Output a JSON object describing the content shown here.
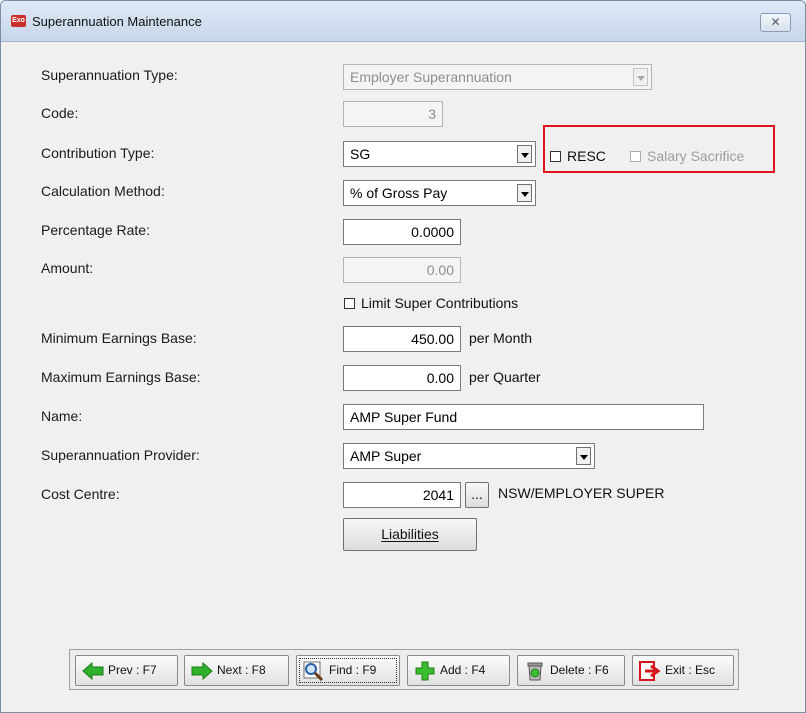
{
  "window": {
    "title": "Superannuation Maintenance",
    "app_icon_text": "Exo",
    "close_symbol": "✕"
  },
  "form": {
    "super_type": {
      "label": "Superannuation Type:",
      "value": "Employer Superannuation"
    },
    "code": {
      "label": "Code:",
      "value": "3"
    },
    "contribution_type": {
      "label": "Contribution Type:",
      "value": "SG"
    },
    "resc": {
      "label": "RESC",
      "checked": false
    },
    "salary_sacrifice": {
      "label": "Salary Sacrifice",
      "checked": false,
      "enabled": false
    },
    "calc_method": {
      "label": "Calculation Method:",
      "value": "% of Gross Pay"
    },
    "percentage_rate": {
      "label": "Percentage Rate:",
      "value": "0.0000"
    },
    "amount": {
      "label": "Amount:",
      "value": "0.00"
    },
    "limit_super": {
      "label": "Limit Super Contributions",
      "checked": false
    },
    "min_earnings": {
      "label": "Minimum Earnings Base:",
      "value": "450.00",
      "unit": "per Month"
    },
    "max_earnings": {
      "label": "Maximum Earnings Base:",
      "value": "0.00",
      "unit": "per Quarter"
    },
    "name": {
      "label": "Name:",
      "value": "AMP Super Fund"
    },
    "provider": {
      "label": "Superannuation Provider:",
      "value": "AMP Super"
    },
    "cost_centre": {
      "label": "Cost Centre:",
      "value": "2041",
      "browse": "...",
      "description": "NSW/EMPLOYER SUPER"
    },
    "liabilities_button": "Liabilities"
  },
  "nav": {
    "prev": "Prev : F7",
    "next": "Next : F8",
    "find": "Find : F9",
    "add": "Add : F4",
    "delete": "Delete : F6",
    "exit": "Exit : Esc"
  },
  "colors": {
    "highlight": "#e0141a",
    "arrow_green": "#2fb12a",
    "exit_red": "#d4141a"
  }
}
